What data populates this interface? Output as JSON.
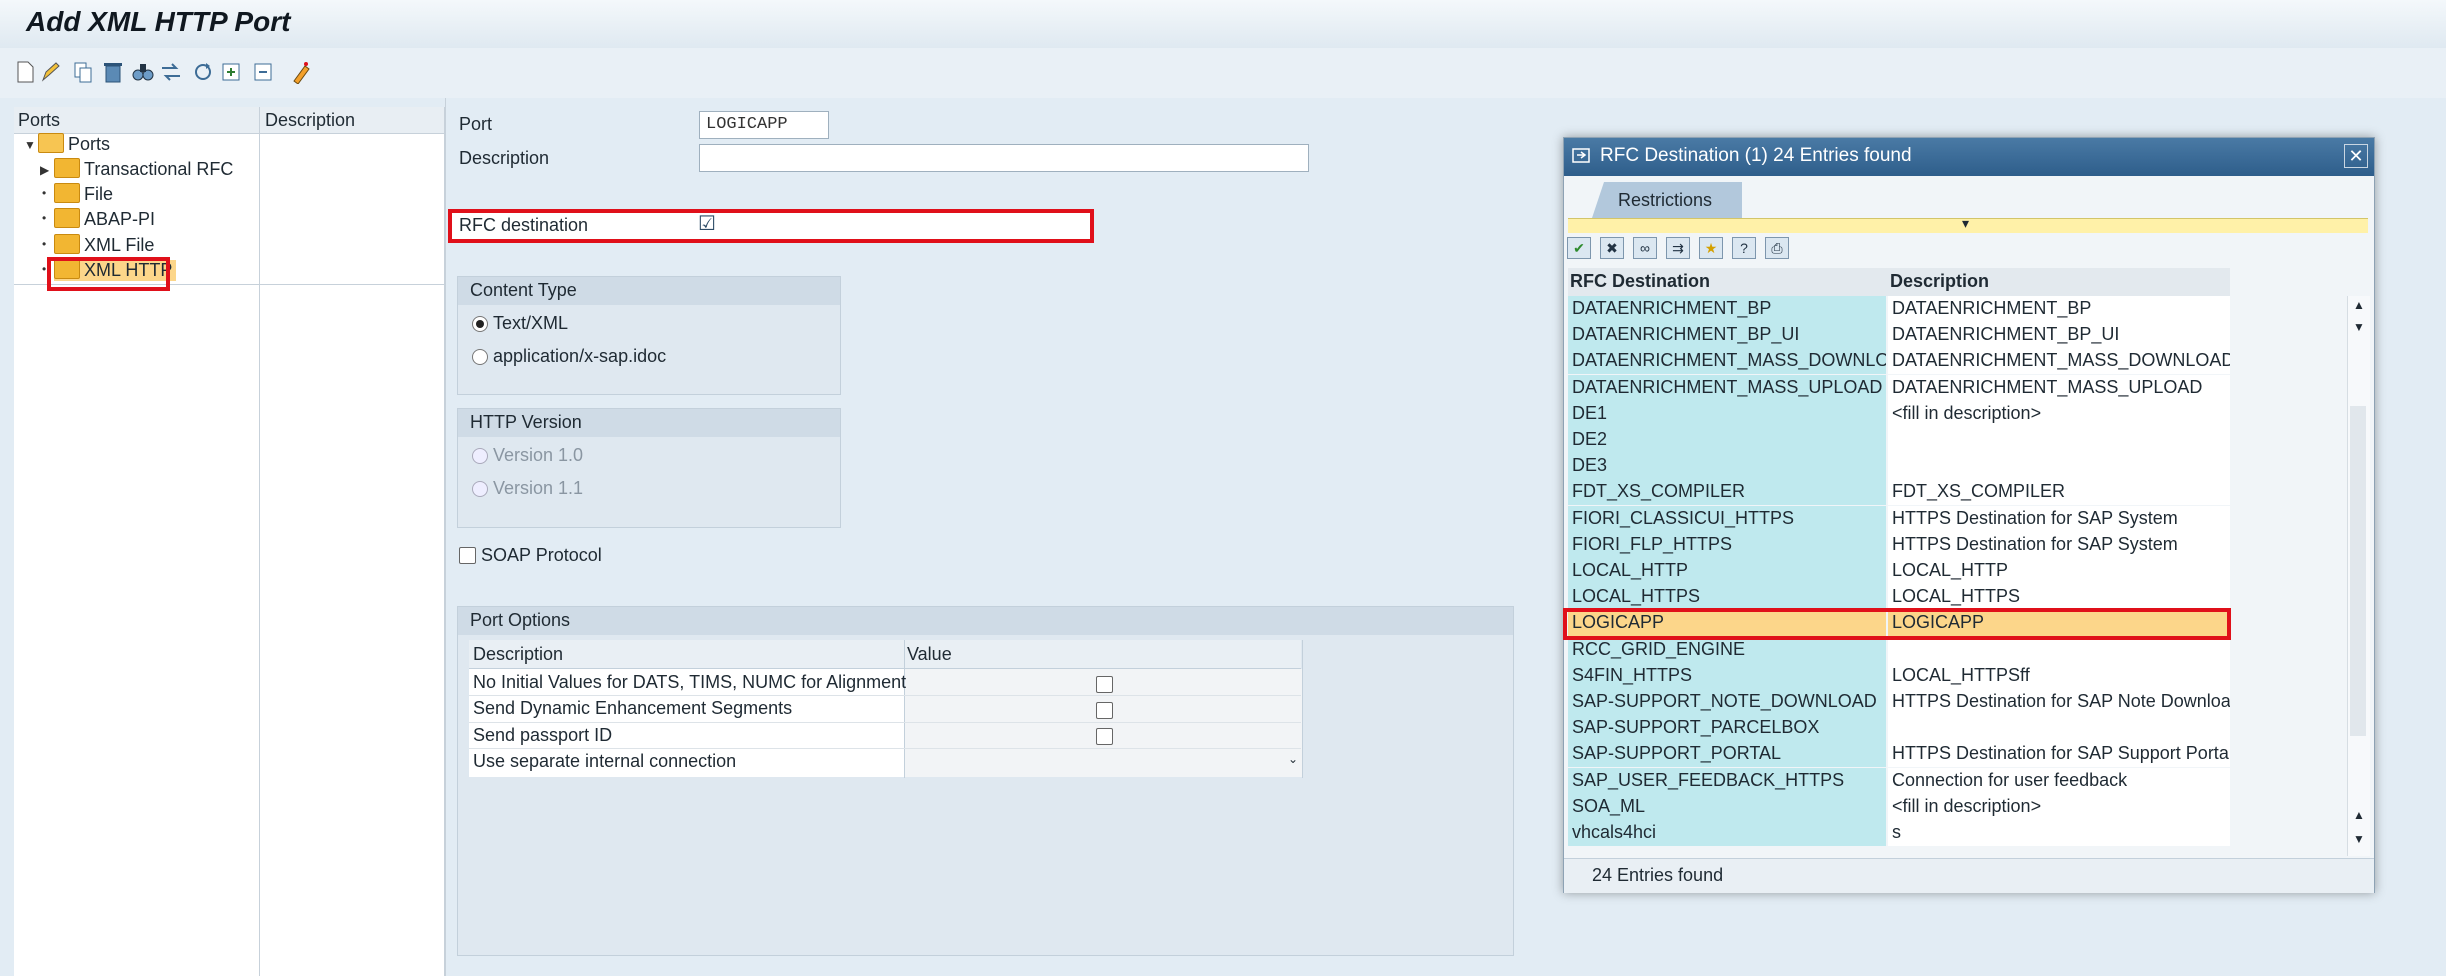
{
  "window": {
    "title": "Add XML HTTP Port"
  },
  "toolbar": {
    "icons": [
      "new-icon",
      "edit-icon",
      "copy-icon",
      "delete-icon",
      "find-icon",
      "transfer-icon",
      "refresh-icon",
      "expand-icon",
      "collapse-icon",
      "wizard-icon"
    ]
  },
  "tree": {
    "col_ports": "Ports",
    "col_desc": "Description",
    "root": "Ports",
    "items": [
      "Transactional RFC",
      "File",
      "ABAP-PI",
      "XML File",
      "XML HTTP"
    ]
  },
  "form": {
    "port_label": "Port",
    "port_value": "LOGICAPP",
    "description_label": "Description",
    "description_value": "",
    "rfc_label": "RFC destination",
    "rfc_checked_glyph": "☑"
  },
  "content_type": {
    "title": "Content Type",
    "options": [
      "Text/XML",
      "application/x-sap.idoc"
    ],
    "selected": "Text/XML"
  },
  "http_version": {
    "title": "HTTP Version",
    "options": [
      "Version 1.0",
      "Version 1.1"
    ]
  },
  "soap": {
    "label": "SOAP Protocol"
  },
  "port_options": {
    "title": "Port Options",
    "col_desc": "Description",
    "col_value": "Value",
    "rows": [
      "No Initial Values for DATS, TIMS, NUMC for Alignment",
      "Send Dynamic Enhancement Segments",
      "Send passport ID",
      "Use separate internal connection"
    ]
  },
  "dialog": {
    "title": "RFC Destination (1)   24 Entries found",
    "tab": "Restrictions",
    "col_dest": "RFC Destination",
    "col_desc": "Description",
    "footer": "24 Entries found",
    "selected": "LOGICAPP",
    "rows": [
      {
        "dest": "DATAENRICHMENT_BP",
        "desc": "DATAENRICHMENT_BP"
      },
      {
        "dest": "DATAENRICHMENT_BP_UI",
        "desc": "DATAENRICHMENT_BP_UI"
      },
      {
        "dest": "DATAENRICHMENT_MASS_DOWNLOAD",
        "desc": "DATAENRICHMENT_MASS_DOWNLOAD"
      },
      {
        "dest": "DATAENRICHMENT_MASS_UPLOAD",
        "desc": "DATAENRICHMENT_MASS_UPLOAD"
      },
      {
        "dest": "DE1",
        "desc": "<fill in description>"
      },
      {
        "dest": "DE2",
        "desc": ""
      },
      {
        "dest": "DE3",
        "desc": ""
      },
      {
        "dest": "FDT_XS_COMPILER",
        "desc": "FDT_XS_COMPILER"
      },
      {
        "dest": "FIORI_CLASSICUI_HTTPS",
        "desc": "HTTPS Destination for SAP System"
      },
      {
        "dest": "FIORI_FLP_HTTPS",
        "desc": "HTTPS Destination for SAP System"
      },
      {
        "dest": "LOCAL_HTTP",
        "desc": "LOCAL_HTTP"
      },
      {
        "dest": "LOCAL_HTTPS",
        "desc": "LOCAL_HTTPS"
      },
      {
        "dest": "LOGICAPP",
        "desc": "LOGICAPP"
      },
      {
        "dest": "RCC_GRID_ENGINE",
        "desc": ""
      },
      {
        "dest": "S4FIN_HTTPS",
        "desc": "LOCAL_HTTPSff"
      },
      {
        "dest": "SAP-SUPPORT_NOTE_DOWNLOAD",
        "desc": "HTTPS Destination for SAP Note Download"
      },
      {
        "dest": "SAP-SUPPORT_PARCELBOX",
        "desc": ""
      },
      {
        "dest": "SAP-SUPPORT_PORTAL",
        "desc": "HTTPS Destination for SAP Support Portal"
      },
      {
        "dest": "SAP_USER_FEEDBACK_HTTPS",
        "desc": "Connection for user feedback"
      },
      {
        "dest": "SOA_ML",
        "desc": "<fill in description>"
      },
      {
        "dest": "vhcals4hci",
        "desc": "s"
      }
    ]
  },
  "colors": {
    "highlight": "#e0101a",
    "selected_row": "#fcd68a",
    "key_column": "#bfe9ee"
  }
}
